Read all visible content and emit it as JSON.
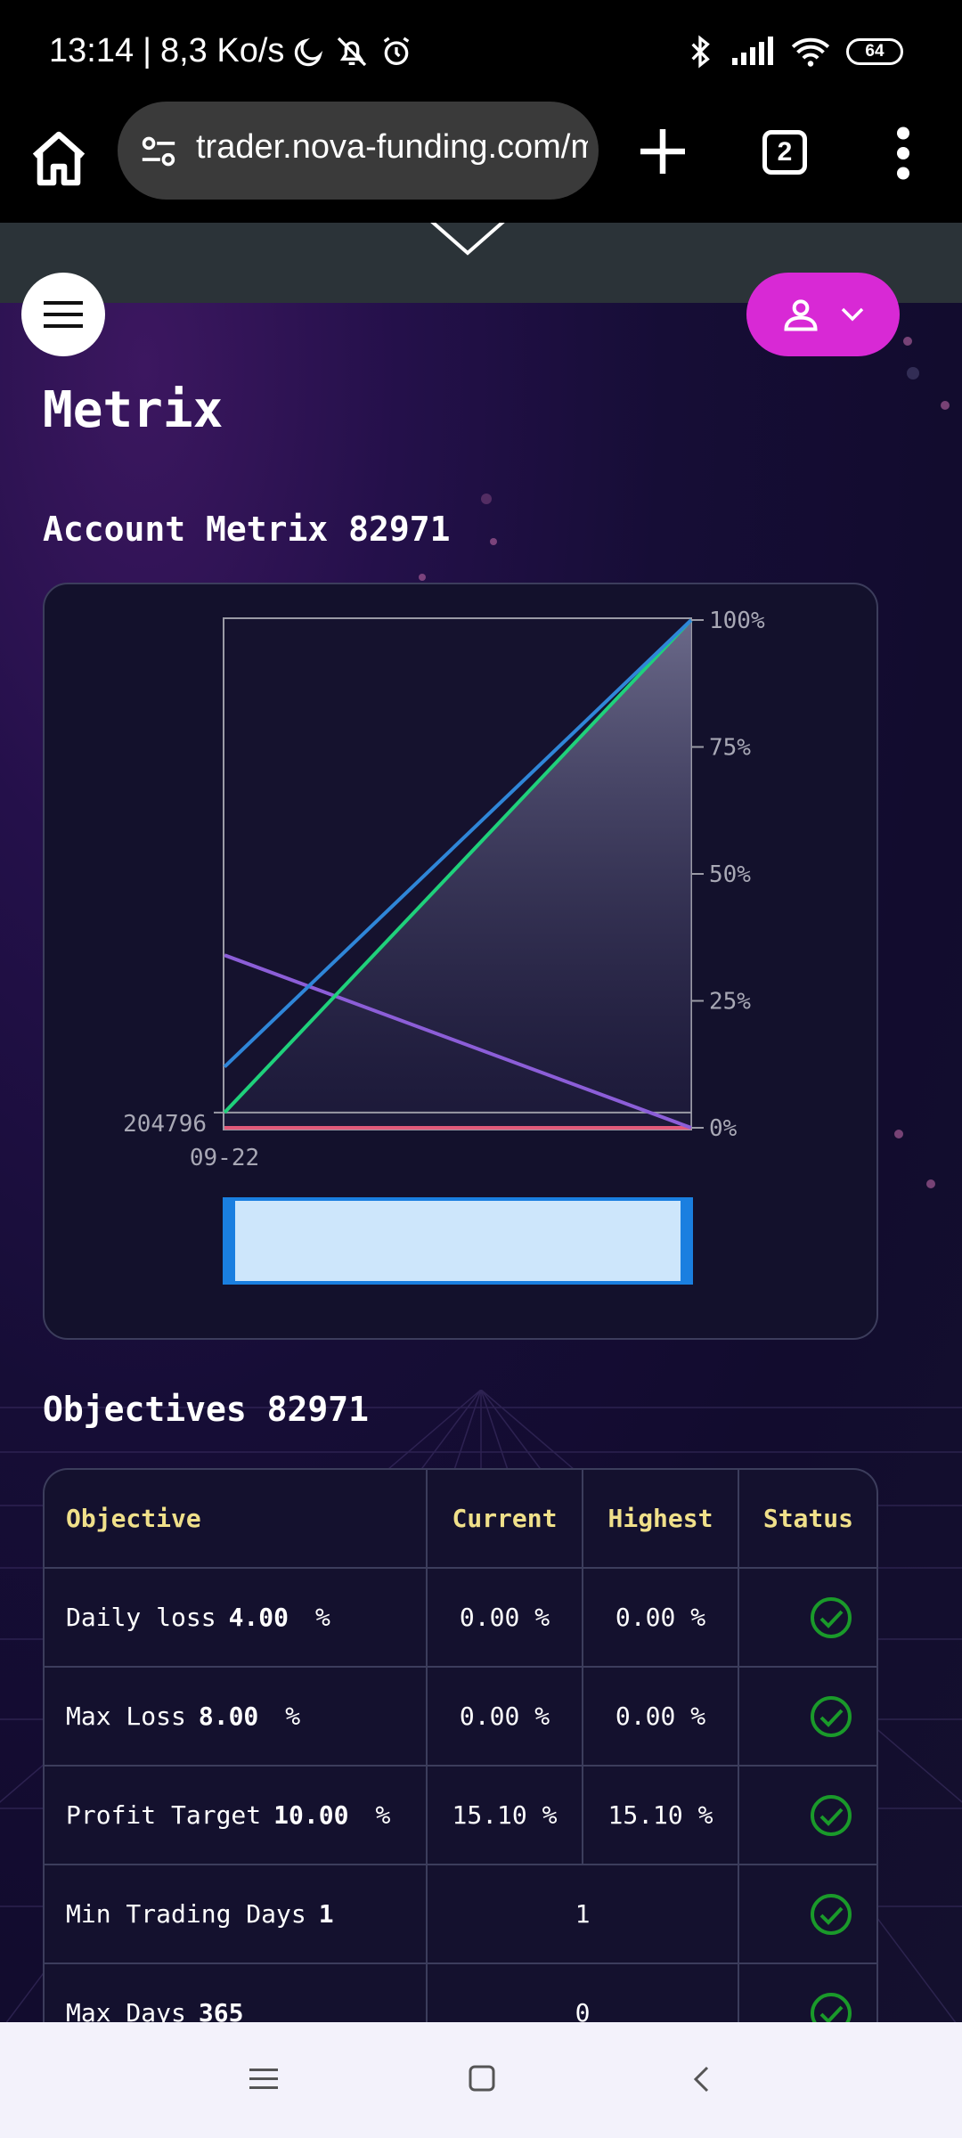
{
  "status_bar": {
    "time": "13:14",
    "speed": "8,3 Ko/s",
    "battery": "64",
    "icons": [
      "moon-icon",
      "notifications-off-icon",
      "alarm-icon",
      "bluetooth-icon",
      "signal-icon",
      "wifi-icon",
      "battery-icon"
    ]
  },
  "browser": {
    "url": "trader.nova-funding.com/metrix",
    "tab_count": "2"
  },
  "page": {
    "title": "Metrix",
    "account_heading": "Account Metrix 82971",
    "objectives_heading": "Objectives 82971"
  },
  "chart_data": {
    "type": "line",
    "title": "",
    "x_label": "09-22",
    "y_left_label": "204796",
    "y_right_ticks": [
      "100%",
      "75%",
      "50%",
      "25%",
      "0%"
    ],
    "ylim": [
      0,
      100
    ],
    "series": [
      {
        "color": "#2f86d8",
        "values": [
          12,
          100
        ]
      },
      {
        "color": "#1fd17b",
        "values": [
          3,
          100
        ]
      },
      {
        "color": "#8c5ed8",
        "values": [
          34,
          0
        ]
      },
      {
        "color": "#e25a7a",
        "values": [
          0,
          0
        ]
      }
    ],
    "area_fill": {
      "color": "#6c6a8a",
      "values": [
        3,
        100
      ]
    }
  },
  "objectives": {
    "headers": [
      "Objective",
      "Current",
      "Highest",
      "Status"
    ],
    "rows": [
      {
        "label": "Daily loss",
        "value": "4.00",
        "unit": "%",
        "current": "0.00 %",
        "highest": "0.00 %",
        "status": "passed"
      },
      {
        "label": "Max Loss",
        "value": "8.00",
        "unit": "%",
        "current": "0.00 %",
        "highest": "0.00 %",
        "status": "passed"
      },
      {
        "label": "Profit Target",
        "value": "10.00",
        "unit": "%",
        "current": "15.10 %",
        "highest": "15.10 %",
        "status": "passed"
      },
      {
        "label": "Min Trading Days",
        "value": "1",
        "unit": "",
        "merged": "1",
        "status": "passed"
      },
      {
        "label": "Max Days",
        "value": "365",
        "unit": "",
        "merged": "0",
        "status": "passed"
      }
    ]
  },
  "colors": {
    "accent": "#d829d5",
    "header_text": "#f0e08a",
    "status_ok": "#1a9a2a"
  }
}
